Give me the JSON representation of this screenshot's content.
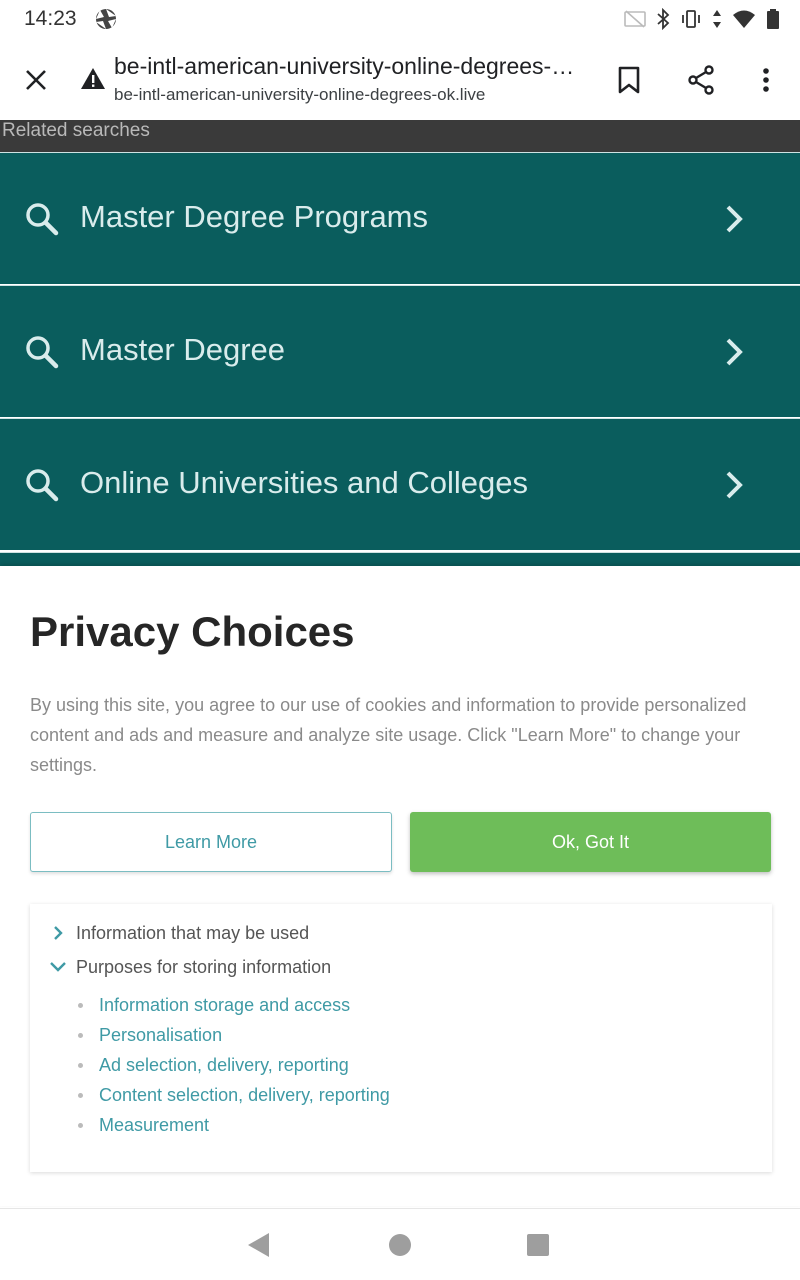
{
  "status_bar": {
    "time": "14:23",
    "left_icon": "aperture-icon",
    "right_icons": [
      "cast-off-icon",
      "bluetooth-icon",
      "vibrate-icon",
      "data-arrows-icon",
      "wifi-icon",
      "battery-icon"
    ]
  },
  "toolbar": {
    "page_title": "be-intl-american-university-online-degrees-ok.live",
    "url": "be-intl-american-university-online-degrees-ok.live",
    "icons": [
      "close-icon",
      "warning-icon",
      "bookmark-icon",
      "share-icon",
      "more-vert-icon"
    ]
  },
  "related": {
    "header": "Related searches",
    "items": [
      {
        "label": "Master Degree Programs"
      },
      {
        "label": "Master Degree"
      },
      {
        "label": "Online Universities and Colleges"
      }
    ]
  },
  "privacy": {
    "title": "Privacy Choices",
    "description": "By using this site, you agree to our use of cookies and information to provide personalized content and ads and measure and analyze site usage. Click \"Learn More\" to change your settings.",
    "learn_more": "Learn More",
    "ok": "Ok, Got It",
    "sections": [
      {
        "label": "Information that may be used",
        "expanded": false
      },
      {
        "label": "Purposes for storing information",
        "expanded": true
      }
    ],
    "purposes": [
      "Information storage and access",
      "Personalisation",
      "Ad selection, delivery, reporting",
      "Content selection, delivery, reporting",
      "Measurement"
    ]
  },
  "colors": {
    "teal_row": "#0a5d5d",
    "accent_link": "#3f9aa5",
    "ok_button": "#6ebd59",
    "related_header_bg": "#3a3a3a"
  },
  "nav_bar": {
    "icons": [
      "back-triangle-icon",
      "home-circle-icon",
      "recents-square-icon"
    ]
  }
}
